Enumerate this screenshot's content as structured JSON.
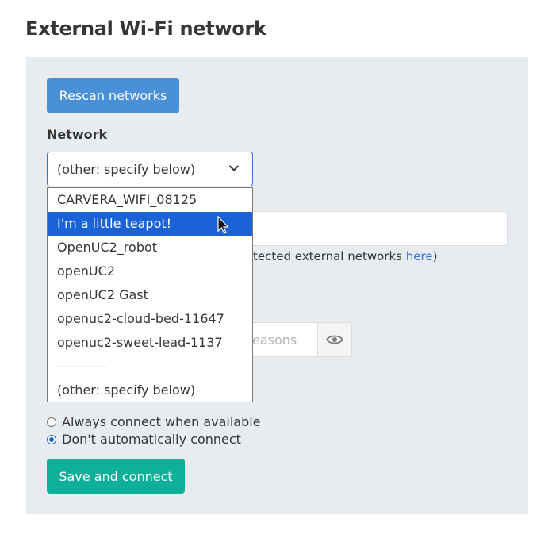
{
  "page": {
    "title": "External Wi-Fi network"
  },
  "form": {
    "rescan_label": "Rescan networks",
    "network_label": "Network",
    "network_selected": "(other: specify below)",
    "network_options": [
      "CARVERA_WIFI_08125",
      "I'm a little teapot!",
      "OpenUC2_robot",
      "openUC2",
      "openUC2 Gast",
      "openuc2-cloud-bed-11647",
      "openuc2-sweet-lead-1137",
      "————",
      "(other: specify below)"
    ],
    "highlighted_option": "I'm a little teapot!",
    "help_text": "tected external networks ",
    "help_link": "here",
    "help_suffix": ")",
    "password_placeholder": "easons",
    "autoconnect_options": [
      {
        "label": "Always connect when available",
        "checked": false
      },
      {
        "label": "Don't automatically connect",
        "checked": true
      }
    ],
    "save_label": "Save and connect"
  },
  "icons": {
    "select_arrow": "chevron-down-icon",
    "password_toggle": "eye-icon",
    "cursor": "mouse-pointer-icon"
  },
  "colors": {
    "primary_button": "#4a90d9",
    "success_button": "#0fb09a",
    "highlight": "#1a62d6",
    "link": "#3273dc",
    "panel": "#e8ebf0"
  }
}
